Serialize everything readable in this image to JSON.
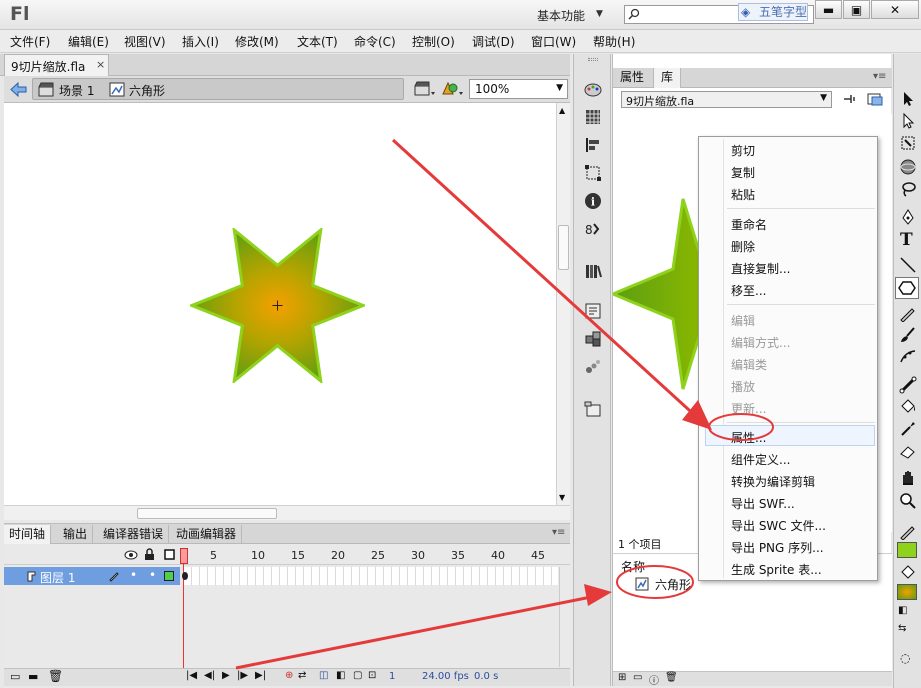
{
  "app": {
    "logo": "Fl",
    "workspace": "基本功能",
    "watermark": "五笔字型"
  },
  "menu": [
    "文件(F)",
    "编辑(E)",
    "视图(V)",
    "插入(I)",
    "修改(M)",
    "文本(T)",
    "命令(C)",
    "控制(O)",
    "调试(D)",
    "窗口(W)",
    "帮助(H)"
  ],
  "document": {
    "tab_label": "9切片缩放.fla",
    "tab_close": "×"
  },
  "nav": {
    "scene": "场景 1",
    "symbol": "六角形",
    "zoom": "100%"
  },
  "timeline": {
    "tabs": [
      "时间轴",
      "输出",
      "编译器错误",
      "动画编辑器"
    ],
    "frame_numbers": [
      "1",
      "5",
      "10",
      "15",
      "20",
      "25",
      "30",
      "35",
      "40",
      "45"
    ],
    "layer": "图层 1",
    "current_frame": "1",
    "fps": "24.00 fps",
    "time": "0.0 s"
  },
  "library": {
    "tabs": [
      "属性",
      "库"
    ],
    "file": "9切片缩放.fla",
    "count": "1 个项目",
    "column_name": "名称",
    "item": "六角形"
  },
  "context_menu": {
    "items": [
      {
        "label": "剪切",
        "disabled": false
      },
      {
        "label": "复制",
        "disabled": false
      },
      {
        "label": "粘贴",
        "disabled": false
      },
      {
        "label": "重命名",
        "disabled": false
      },
      {
        "label": "删除",
        "disabled": false
      },
      {
        "label": "直接复制...",
        "disabled": false
      },
      {
        "label": "移至...",
        "disabled": false
      },
      {
        "label": "编辑",
        "disabled": true
      },
      {
        "label": "编辑方式...",
        "disabled": true
      },
      {
        "label": "编辑类",
        "disabled": true
      },
      {
        "label": "播放",
        "disabled": true
      },
      {
        "label": "更新...",
        "disabled": true
      },
      {
        "label": "属性...",
        "disabled": false
      },
      {
        "label": "组件定义...",
        "disabled": false
      },
      {
        "label": "转换为编译剪辑",
        "disabled": false
      },
      {
        "label": "导出 SWF...",
        "disabled": false
      },
      {
        "label": "导出 SWC 文件...",
        "disabled": false
      },
      {
        "label": "导出 PNG 序列...",
        "disabled": false
      },
      {
        "label": "生成 Sprite 表...",
        "disabled": false
      }
    ]
  },
  "colors": {
    "star_fill_center": "#f0a000",
    "star_fill_edge": "#5c9e12",
    "star_stroke": "#8ed21c",
    "annotation": "#e53a3a",
    "layer_highlight": "#6f9ee0"
  }
}
